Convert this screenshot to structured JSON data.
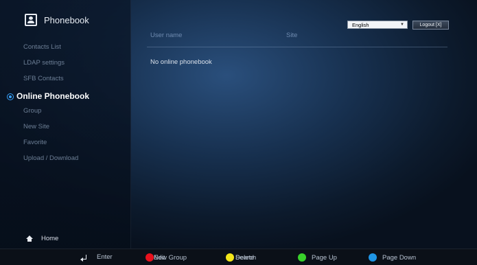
{
  "app": {
    "title": "Phonebook"
  },
  "sidebar": {
    "items": [
      {
        "label": "Contacts List"
      },
      {
        "label": "LDAP settings"
      },
      {
        "label": "SFB Contacts"
      },
      {
        "label": "Online Phonebook",
        "active": true
      },
      {
        "label": "Group"
      },
      {
        "label": "New Site"
      },
      {
        "label": "Favorite"
      },
      {
        "label": "Upload / Download"
      }
    ],
    "home_label": "Home"
  },
  "header": {
    "language_select": "English",
    "logout_label": "Logout [X]"
  },
  "table": {
    "columns": [
      "User name",
      "Site"
    ],
    "empty_message": "No online phonebook"
  },
  "footer": {
    "enter_label": "Enter",
    "red_labels": [
      "New Group",
      "Edit"
    ],
    "yellow_labels": [
      "Search",
      "Delete"
    ],
    "green_label": "Page Up",
    "blue_label": "Page Down"
  },
  "colors": {
    "red": "#e8111d",
    "yellow": "#f3e61a",
    "green": "#39d12b",
    "blue": "#1f96e6",
    "accent": "#39a3ff"
  }
}
